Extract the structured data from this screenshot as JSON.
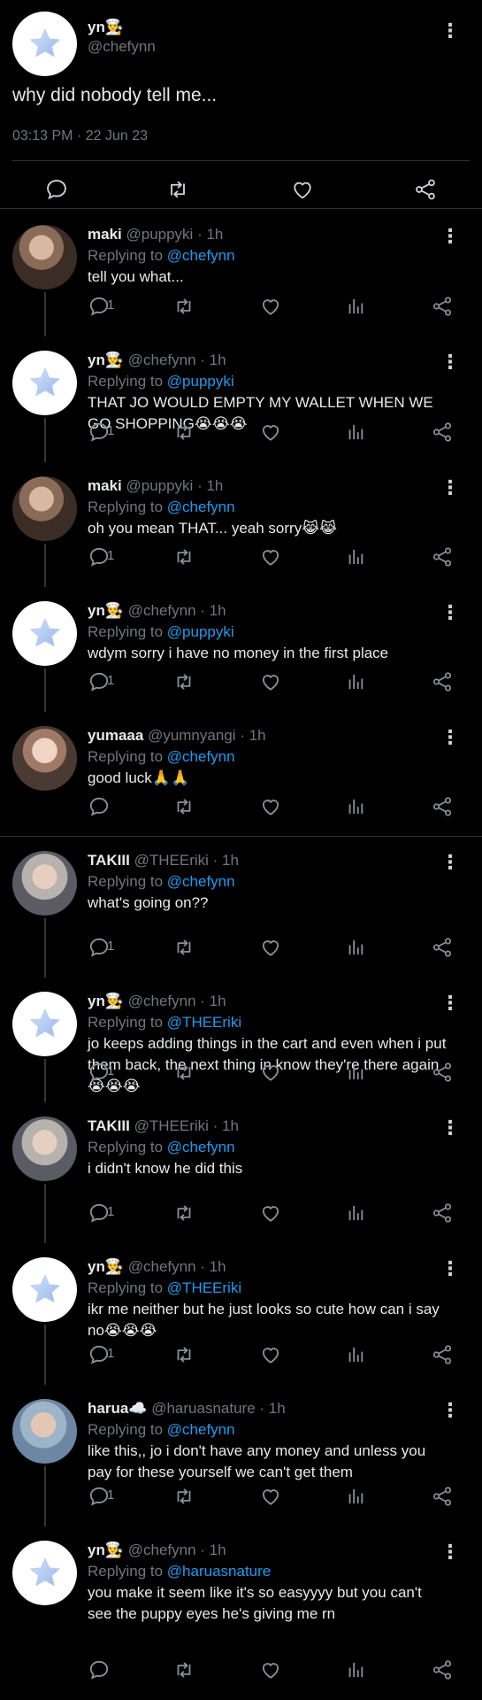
{
  "main_tweet": {
    "name": "yn👨‍🍳",
    "handle": "@chefynn",
    "text": "why did nobody tell me...",
    "time": "03:13 PM · 22 Jun 23"
  },
  "replies": [
    {
      "name": "maki",
      "handle": "@puppyki",
      "age": "· 1h",
      "replying_to_prefix": "Replying to",
      "replying_to": "@chefynn",
      "text": "tell you what...",
      "reply_count": "1",
      "avatar": "photo"
    },
    {
      "name": "yn👨‍🍳",
      "handle": "@chefynn",
      "age": "· 1h",
      "replying_to_prefix": "Replying to",
      "replying_to": "@puppyki",
      "text": "THAT JO WOULD EMPTY MY WALLET WHEN WE GO SHOPPING😭😭😭",
      "reply_count": "1",
      "avatar": "star"
    },
    {
      "name": "maki",
      "handle": "@puppyki",
      "age": "· 1h",
      "replying_to_prefix": "Replying to",
      "replying_to": "@chefynn",
      "text": "oh you mean THAT... yeah sorry😹😹",
      "reply_count": "1",
      "avatar": "photo"
    },
    {
      "name": "yn👨‍🍳",
      "handle": "@chefynn",
      "age": "· 1h",
      "replying_to_prefix": "Replying to",
      "replying_to": "@puppyki",
      "text": "wdym sorry i have no money in the first place",
      "reply_count": "1",
      "avatar": "star"
    },
    {
      "name": "yumaaa",
      "handle": "@yumnyangi",
      "age": "· 1h",
      "replying_to_prefix": "Replying to",
      "replying_to": "@chefynn",
      "text": "good luck🙏🙏",
      "reply_count": "",
      "avatar": "photo2"
    },
    {
      "name": "TAKIII",
      "handle": "@THEEriki",
      "age": "· 1h",
      "replying_to_prefix": "Replying to",
      "replying_to": "@chefynn",
      "text": "what's going on??",
      "reply_count": "1",
      "avatar": "photo3"
    },
    {
      "name": "yn👨‍🍳",
      "handle": "@chefynn",
      "age": "· 1h",
      "replying_to_prefix": "Replying to",
      "replying_to": "@THEEriki",
      "text": "jo keeps adding things in the cart and even when i put them back, the next thing in know they're there again 😭😭😭",
      "reply_count": "1",
      "avatar": "star"
    },
    {
      "name": "TAKIII",
      "handle": "@THEEriki",
      "age": "· 1h",
      "replying_to_prefix": "Replying to",
      "replying_to": "@chefynn",
      "text": "i didn't know he did this",
      "reply_count": "1",
      "avatar": "photo3"
    },
    {
      "name": "yn👨‍🍳",
      "handle": "@chefynn",
      "age": "· 1h",
      "replying_to_prefix": "Replying to",
      "replying_to": "@THEEriki",
      "text": "ikr me neither but he just looks so cute how can i say no😭😭😭",
      "reply_count": "1",
      "avatar": "star"
    },
    {
      "name": "harua☁️",
      "handle": "@haruasnature",
      "age": "· 1h",
      "replying_to_prefix": "Replying to",
      "replying_to": "@chefynn",
      "text": "like this,, jo i don't have any money and unless you pay for these yourself we can't get them",
      "reply_count": "1",
      "avatar": "photo4"
    },
    {
      "name": "yn👨‍🍳",
      "handle": "@chefynn",
      "age": "· 1h",
      "replying_to_prefix": "Replying to",
      "replying_to": "@haruasnature",
      "text": "you make it seem like it's so easyyyy but you can't see the puppy eyes he's giving me rn",
      "reply_count": "",
      "avatar": "star"
    }
  ],
  "colors": {
    "background": "#000000",
    "text": "#e7e9ea",
    "muted": "#71767b",
    "link": "#1d9bf0",
    "divider": "#2f3336"
  }
}
